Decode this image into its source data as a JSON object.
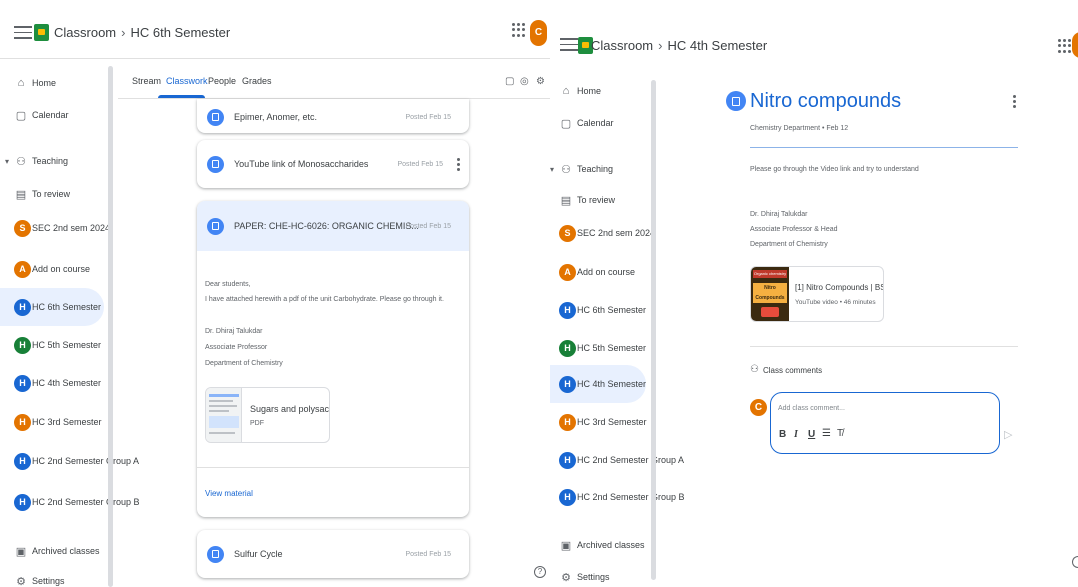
{
  "left": {
    "crumb_class": "Classroom",
    "crumb_sep": "›",
    "crumb_current": "HC 6th Semester",
    "avatar_initial": "C",
    "tabs": [
      {
        "label": "Stream"
      },
      {
        "label": "Classwork"
      },
      {
        "label": "People"
      },
      {
        "label": "Grades"
      }
    ],
    "posts": [
      {
        "title": "Epimer, Anomer, etc.",
        "date": "Posted Feb 15"
      },
      {
        "title": "YouTube link of Monosaccharides",
        "date": "Posted Feb 15"
      },
      {
        "title": "PAPER: CHE-HC-6026: ORGANIC CHEMIS...",
        "date": "Posted Feb 15"
      },
      {
        "title": "Sulfur Cycle",
        "date": "Posted Feb 15"
      }
    ],
    "expanded": {
      "lines": [
        "Dear students,",
        "I have attached herewith a pdf of the unit Carbohydrate. Please go through it.",
        "",
        "Dr. Dhiraj Talukdar",
        "Associate Professor",
        "Department of Chemistry"
      ],
      "attachment_title": "Sugars and polysacchari...",
      "attachment_type": "PDF",
      "view_label": "View material"
    },
    "help_label": "?"
  },
  "right": {
    "crumb_class": "Classroom",
    "crumb_sep": "›",
    "crumb_current": "HC 4th Semester",
    "title": "Nitro compounds",
    "meta": "Chemistry Department • Feb 12",
    "body": "Please go through the Video link and try to understand",
    "signature": [
      "Dr. Dhiraj Talukdar",
      "Associate Professor & Head",
      "Department of Chemistry"
    ],
    "video_title": "[1] Nitro Compounds | BSc 2...",
    "video_meta": "YouTube video • 46 minutes",
    "thumb_text": [
      "Organic chemistry",
      "Nitro",
      "Compounds"
    ],
    "comments_label": "Class comments",
    "comment_placeholder": "Add class comment...",
    "avatar_initial": "C",
    "help_label": "?"
  },
  "sidebar": {
    "items": [
      {
        "label": "Home",
        "icon": "home-icon",
        "glyph": "⌂"
      },
      {
        "label": "Calendar",
        "icon": "calendar-icon",
        "glyph": "▢"
      },
      {
        "label": "Teaching",
        "icon": "teaching-icon",
        "glyph": "⚇"
      },
      {
        "label": "To review",
        "icon": "to-review-icon",
        "glyph": "▤"
      },
      {
        "label": "SEC 2nd sem 2024",
        "initial": "S",
        "color": "#e37400"
      },
      {
        "label": "Add on course",
        "initial": "A",
        "color": "#e37400"
      },
      {
        "label": "HC 6th Semester",
        "initial": "H",
        "color": "#1967d2"
      },
      {
        "label": "HC 5th Semester",
        "initial": "H",
        "color": "#188038"
      },
      {
        "label": "HC 4th Semester",
        "initial": "H",
        "color": "#1967d2"
      },
      {
        "label": "HC 3rd Semester",
        "initial": "H",
        "color": "#e37400"
      },
      {
        "label": "HC 2nd Semester Group A",
        "initial": "H",
        "color": "#1967d2"
      },
      {
        "label": "HC 2nd Semester Group B",
        "initial": "H",
        "color": "#1967d2"
      },
      {
        "label": "Archived classes",
        "icon": "archive-icon",
        "glyph": "▣"
      },
      {
        "label": "Settings",
        "icon": "settings-icon",
        "glyph": "⚙"
      }
    ]
  },
  "colors": {
    "accent": "#1967d2",
    "post_icon": "#4285f4",
    "active_bg": "#e8f0fe",
    "avatar": "#e37400"
  }
}
